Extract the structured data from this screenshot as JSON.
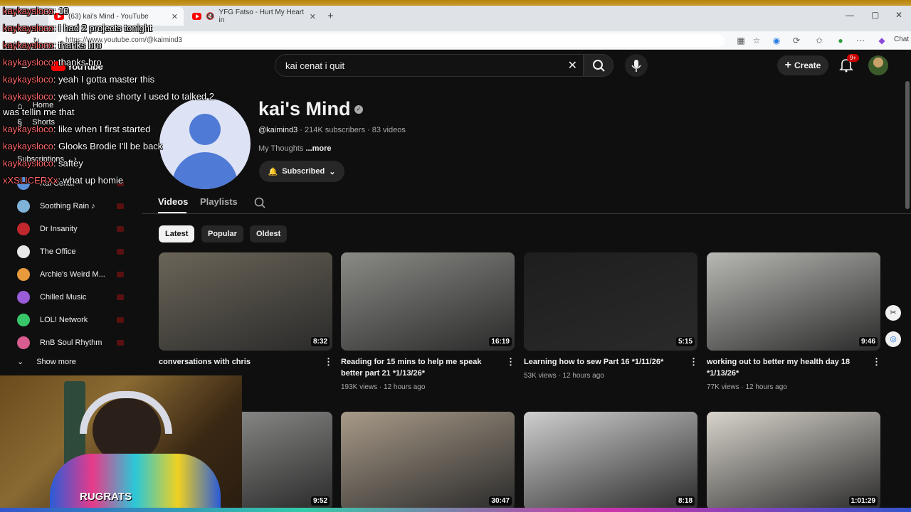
{
  "browser": {
    "tabs": [
      {
        "title": "(63) kai's Mind - YouTube"
      },
      {
        "title": "YFG Fatso - Hurt My Heart in"
      }
    ],
    "new_tab_symbol": "+",
    "url": "https://www.youtube.com/@kaimind3",
    "copilot_label": "Chat"
  },
  "header": {
    "logo_text": "YouTube",
    "search_value": "kai cenat i quit",
    "create_label": "Create",
    "notification_count": "9+"
  },
  "sidebar": {
    "nav": [
      {
        "label": "Home"
      },
      {
        "label": "Shorts"
      }
    ],
    "section_title": "Subscriptions",
    "subscriptions": [
      {
        "label": "Kai Cenat",
        "color": "#5b8fd8"
      },
      {
        "label": "Soothing Rain ♪",
        "color": "#7fb3d8"
      },
      {
        "label": "Dr Insanity",
        "color": "#c0282d"
      },
      {
        "label": "The Office",
        "color": "#e8e8e8"
      },
      {
        "label": "Archie's Weird M...",
        "color": "#e89a3c"
      },
      {
        "label": "Chilled Music",
        "color": "#9a5cd8"
      },
      {
        "label": "LOL! Network",
        "color": "#38c66a"
      },
      {
        "label": "RnB Soul Rhythm",
        "color": "#d85c8f"
      }
    ],
    "show_more": "Show more"
  },
  "channel": {
    "name": "kai's Mind",
    "handle": "@kaimind3",
    "stats": "· 214K subscribers · 83 videos",
    "description": "My Thoughts",
    "more": "...more",
    "subscribed_label": "Subscribed"
  },
  "tabs": [
    {
      "label": "Videos"
    },
    {
      "label": "Playlists"
    }
  ],
  "chips": [
    {
      "label": "Latest"
    },
    {
      "label": "Popular"
    },
    {
      "label": "Oldest"
    }
  ],
  "videos": [
    {
      "title": "conversations with chris",
      "duration": "8:32",
      "meta": "",
      "thumb_color": "#6b6558"
    },
    {
      "title": "Reading for 15 mins to help me speak better part 21 *1/13/26*",
      "duration": "16:19",
      "meta": "193K views · 12 hours ago",
      "thumb_color": "#8a8a86"
    },
    {
      "title": "Learning how to sew Part 16 *1/11/26*",
      "duration": "5:15",
      "meta": "53K views · 12 hours ago",
      "thumb_color": "#1e1e1e"
    },
    {
      "title": "working out to better my health day 18 *1/13/26*",
      "duration": "9:46",
      "meta": "77K views · 12 hours ago",
      "thumb_color": "#b8b8b4"
    },
    {
      "title": "",
      "duration": "9:52",
      "meta": "",
      "thumb_color": "#9a9a98"
    },
    {
      "title": "",
      "duration": "30:47",
      "meta": "",
      "thumb_color": "#a89a88"
    },
    {
      "title": "",
      "duration": "8:18",
      "meta": "",
      "thumb_color": "#cfcfcf"
    },
    {
      "title": "",
      "duration": "1:01:29",
      "meta": "",
      "thumb_color": "#d8d4cc"
    }
  ],
  "chat": [
    {
      "user": "kaykaysloco",
      "text": ": 10"
    },
    {
      "user": "kaykaysloco",
      "text": ": I had 2 projects tonight"
    },
    {
      "user": "kaykaysloco",
      "text": ": thanks bro"
    },
    {
      "user": "kaykaysloco",
      "text": ": thanks bro"
    },
    {
      "user": "kaykaysloco",
      "text": ": yeah I gotta master this"
    },
    {
      "user": "kaykaysloco",
      "text": ": yeah this one shorty I used to talked 2"
    },
    {
      "user": "",
      "text": "was tellin me that"
    },
    {
      "user": "kaykaysloco",
      "text": ": like when I first started"
    },
    {
      "user": "kaykaysloco",
      "text": ": Glooks Brodie I'll be back"
    },
    {
      "user": "kaykaysloco",
      "text": ": saftey"
    },
    {
      "user": "xXSLICERXx",
      "text": ": what up homie"
    }
  ],
  "webcam": {
    "shirt_text": "RUGRATS"
  },
  "colors": {
    "bg": "#0f0f0f",
    "accent_red": "#ff0000",
    "chip_active": "#f1f1f1"
  }
}
